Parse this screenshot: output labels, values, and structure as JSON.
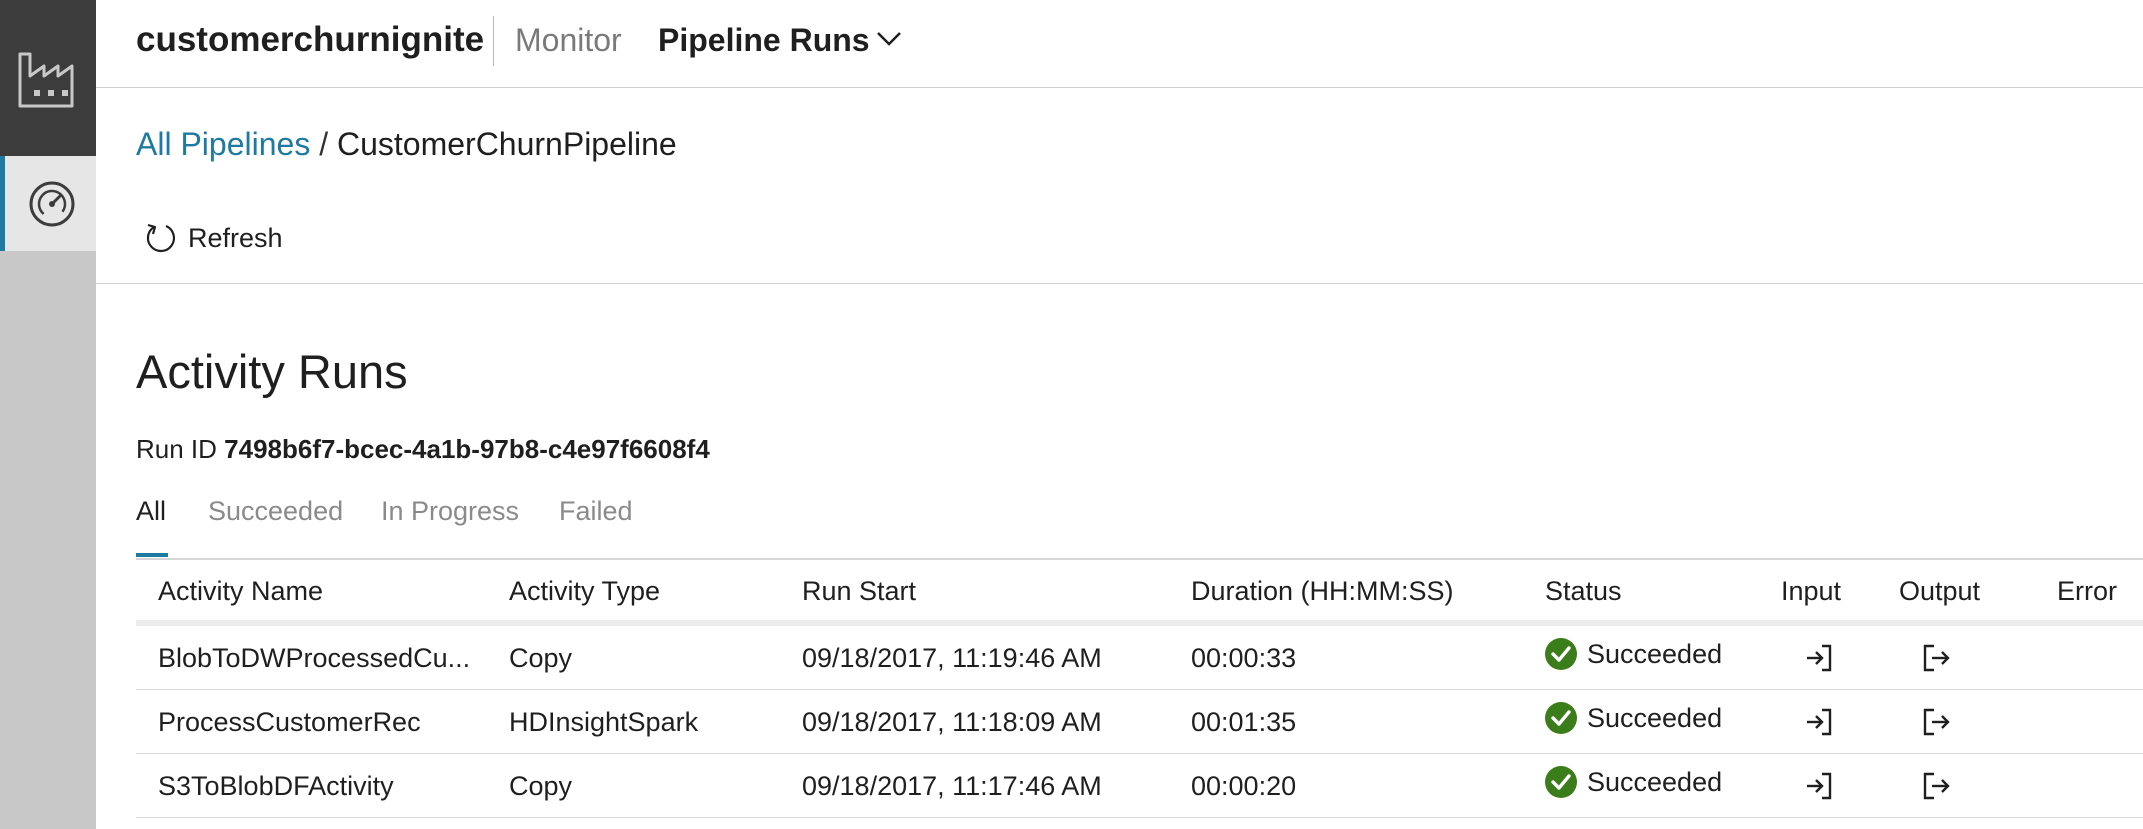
{
  "header": {
    "factory_name": "customerchurnignite",
    "section": "Monitor",
    "view": "Pipeline Runs"
  },
  "breadcrumb": {
    "parent": "All Pipelines",
    "separator": "/",
    "current": "CustomerChurnPipeline"
  },
  "toolbar": {
    "refresh_label": "Refresh"
  },
  "page": {
    "title": "Activity Runs",
    "run_id_label": "Run ID",
    "run_id_value": "7498b6f7-bcec-4a1b-97b8-c4e97f6608f4"
  },
  "tabs": [
    {
      "label": "All",
      "active": true
    },
    {
      "label": "Succeeded",
      "active": false
    },
    {
      "label": "In Progress",
      "active": false
    },
    {
      "label": "Failed",
      "active": false
    }
  ],
  "table": {
    "columns": [
      "Activity Name",
      "Activity Type",
      "Run Start",
      "Duration (HH:MM:SS)",
      "Status",
      "Input",
      "Output",
      "Error"
    ],
    "rows": [
      {
        "name": "BlobToDWProcessedCu...",
        "type": "Copy",
        "start": "09/18/2017, 11:19:46 AM",
        "duration": "00:00:33",
        "status": "Succeeded"
      },
      {
        "name": "ProcessCustomerRec",
        "type": "HDInsightSpark",
        "start": "09/18/2017, 11:18:09 AM",
        "duration": "00:01:35",
        "status": "Succeeded"
      },
      {
        "name": "S3ToBlobDFActivity",
        "type": "Copy",
        "start": "09/18/2017, 11:17:46 AM",
        "duration": "00:00:20",
        "status": "Succeeded"
      }
    ]
  },
  "icons": {
    "rail_factory": "factory-icon",
    "rail_monitor": "gauge-icon",
    "refresh": "refresh-icon",
    "status_success": "check-circle-icon",
    "input": "input-arrow-icon",
    "output": "output-arrow-icon"
  },
  "colors": {
    "accent": "#1e7aa0",
    "success": "#3a7d1a",
    "rail_dark": "#3c3c3c",
    "rail_light": "#c8c8c8"
  }
}
